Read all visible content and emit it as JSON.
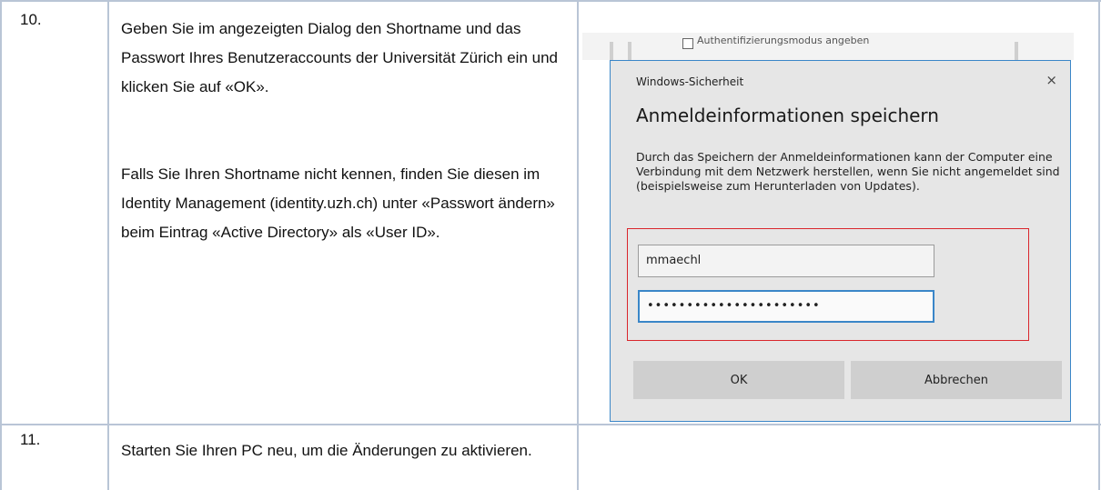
{
  "steps": [
    {
      "number": "10.",
      "paragraphs": [
        "Geben Sie im angezeigten Dialog den Shortname und das Passwort Ihres Benutzeraccounts der Universität Zürich ein und klicken Sie auf «OK».",
        "Falls Sie Ihren Shortname nicht kennen, finden Sie diesen im Identity Management (identity.uzh.ch) unter «Passwort ändern» beim Eintrag «Active Directory» als «User ID»."
      ]
    },
    {
      "number": "11.",
      "paragraphs": [
        "Starten Sie Ihren PC neu, um die Änderungen zu aktivieren."
      ]
    }
  ],
  "dialog": {
    "background_text": "Authentifizierungsmodus angeben",
    "window_title": "Windows-Sicherheit",
    "close_glyph": "×",
    "heading": "Anmeldeinformationen speichern",
    "description": "Durch das Speichern der Anmeldeinformationen kann der Computer eine Verbindung mit dem Netzwerk herstellen, wenn Sie nicht angemeldet sind (beispielsweise zum Herunterladen von Updates).",
    "username_value": "mmaechl",
    "password_masked": "••••••••••••••••••••••",
    "ok_label": "OK",
    "cancel_label": "Abbrechen"
  },
  "colors": {
    "table_border": "#b9c5d6",
    "highlight": "#d9262c",
    "accent": "#3a86c8"
  }
}
